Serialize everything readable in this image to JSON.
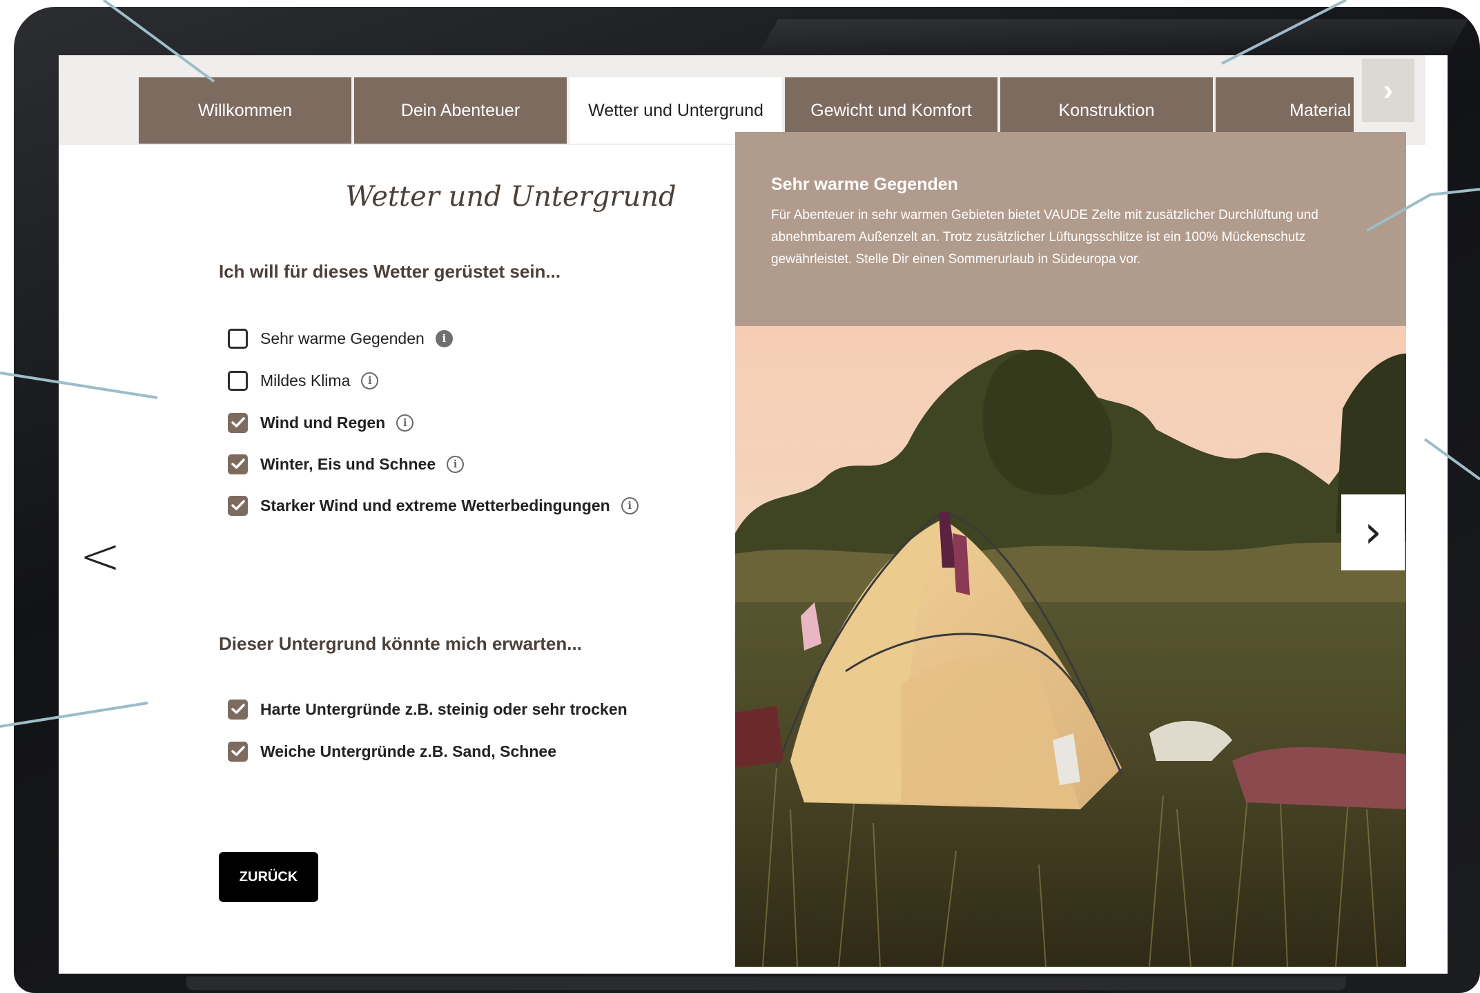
{
  "tabs": [
    {
      "label": "Willkommen",
      "active": false
    },
    {
      "label": "Dein Abenteuer",
      "active": false
    },
    {
      "label": "Wetter und Untergrund",
      "active": true
    },
    {
      "label": "Gewicht und Komfort",
      "active": false
    },
    {
      "label": "Konstruktion",
      "active": false
    },
    {
      "label": "Material",
      "active": false
    }
  ],
  "tab_next_icon": "chevron-right-icon",
  "page": {
    "heading": "Wetter und Untergrund",
    "weather_question": "Ich will für dieses Wetter gerüstet sein...",
    "weather_options": [
      {
        "label": "Sehr warme Gegenden",
        "checked": false
      },
      {
        "label": "Mildes Klima",
        "checked": false
      },
      {
        "label": "Wind und Regen",
        "checked": true
      },
      {
        "label": "Winter, Eis und Schnee",
        "checked": true
      },
      {
        "label": "Starker Wind und extreme Wetterbedingungen",
        "checked": true
      }
    ],
    "ground_question": "Dieser Untergrund könnte mich erwarten...",
    "ground_options": [
      {
        "label": "Harte Untergründe z.B. steinig oder sehr trocken",
        "checked": true
      },
      {
        "label": "Weiche Untergründe z.B. Sand, Schnee",
        "checked": true
      }
    ],
    "back_button": "ZURÜCK"
  },
  "info_panel": {
    "title": "Sehr warme Gegenden",
    "text": "Für Abenteuer in sehr warmen Gebieten bietet VAUDE Zelte mit zusätzlicher Durchlüftung und abnehmbarem Außenzelt an. Trotz zusätzlicher Lüftungsschlitze ist ein 100% Mückenschutz gewährleistet. Stelle Dir einen Sommerurlaub in Südeuropa vor."
  },
  "colors": {
    "tab_brown": "#7e6b60",
    "panel_taupe": "#b19b8c",
    "callout_line": "#9dbdc8"
  }
}
